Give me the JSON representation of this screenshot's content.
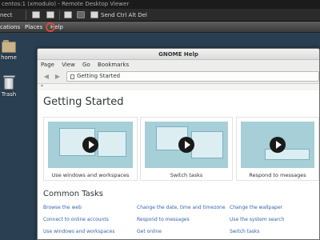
{
  "viewer": {
    "title": "centos:1 (xmodulo) - Remote Desktop Viewer",
    "connect": "nect",
    "send_keys": "Send Ctrl Alt Del"
  },
  "panel": {
    "applications": "cations",
    "places": "Places",
    "help": "Help"
  },
  "desktop": {
    "home_label": "home",
    "trash_label": "Trash"
  },
  "help_window": {
    "title": "GNOME Help",
    "menu": [
      "Page",
      "View",
      "Go",
      "Bookmarks"
    ],
    "path": "Getting Started",
    "search_marker": "*",
    "page_title": "Getting Started",
    "videos": [
      {
        "label": "Use windows and workspaces"
      },
      {
        "label": "Switch tasks"
      },
      {
        "label": "Respond to messages"
      }
    ],
    "common_tasks_title": "Common Tasks",
    "tasks": [
      [
        "Browse the web",
        "Change the date, time and timezone",
        "Change the wallpaper"
      ],
      [
        "Connect to online accounts",
        "Respond to messages",
        "Use the system search"
      ],
      [
        "Use windows and workspaces",
        "Get online",
        "Switch tasks"
      ]
    ]
  },
  "colors": {
    "link": "#3465a4",
    "thumb": "#a6cfd8"
  }
}
